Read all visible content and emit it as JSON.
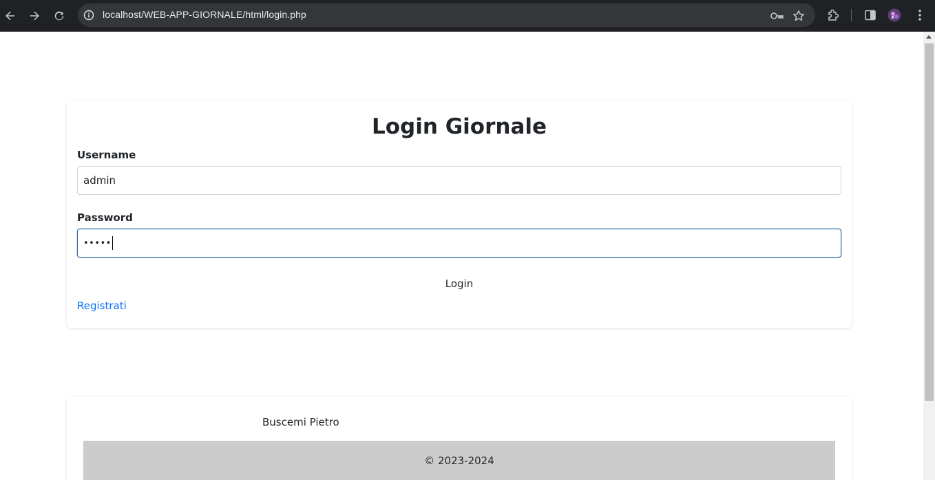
{
  "browser": {
    "url": "localhost/WEB-APP-GIORNALE/html/login.php",
    "icons": [
      "back-arrow-icon",
      "forward-arrow-icon",
      "reload-icon",
      "site-info-icon",
      "password-key-icon",
      "bookmark-star-icon",
      "extensions-icon",
      "side-panel-icon",
      "profile-avatar",
      "more-menu-icon"
    ]
  },
  "login": {
    "title": "Login Giornale",
    "username_label": "Username",
    "username_value": "admin",
    "password_label": "Password",
    "password_value": "•••••",
    "login_button": "Login",
    "register_link": "Registrati"
  },
  "footer": {
    "author": "Buscemi Pietro",
    "copyright": "© 2023-2024"
  },
  "colors": {
    "accent_link": "#0d6efd",
    "focus_border": "#2f6ea8",
    "copyright_bar": "#cccccc",
    "chrome_bg": "#202124"
  }
}
